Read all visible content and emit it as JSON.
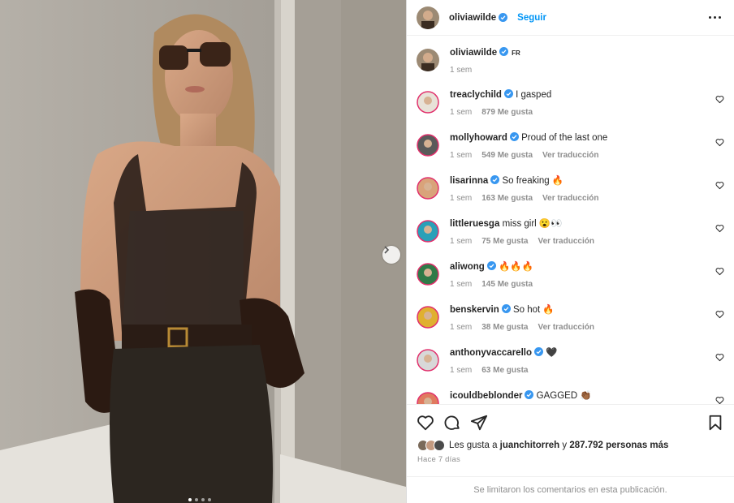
{
  "post": {
    "author": "oliviawilde",
    "follow_label": "Seguir",
    "caption_time": "1 sem",
    "caption_lang": "FR"
  },
  "comments": [
    {
      "user": "treaclychild",
      "verified": true,
      "text": "I gasped",
      "time": "1 sem",
      "likes": "879 Me gusta",
      "translate": "",
      "avatar_color": "#e8e2d8"
    },
    {
      "user": "mollyhoward",
      "verified": true,
      "text": "Proud of the last one",
      "time": "1 sem",
      "likes": "549 Me gusta",
      "translate": "Ver traducción",
      "avatar_color": "#5a5a5a"
    },
    {
      "user": "lisarinna",
      "verified": true,
      "text": "So freaking 🔥",
      "time": "1 sem",
      "likes": "163 Me gusta",
      "translate": "Ver traducción",
      "avatar_color": "#d9a37a"
    },
    {
      "user": "littleruesga",
      "verified": false,
      "text": "miss girl 😮👀",
      "time": "1 sem",
      "likes": "75 Me gusta",
      "translate": "Ver traducción",
      "avatar_color": "#2aa0b8"
    },
    {
      "user": "aliwong",
      "verified": true,
      "text": "🔥🔥🔥",
      "time": "1 sem",
      "likes": "145 Me gusta",
      "translate": "",
      "avatar_color": "#2f7a48"
    },
    {
      "user": "benskervin",
      "verified": true,
      "text": "So hot 🔥",
      "time": "1 sem",
      "likes": "38 Me gusta",
      "translate": "Ver traducción",
      "avatar_color": "#e0b030"
    },
    {
      "user": "anthonyvaccarello",
      "verified": true,
      "text": "🖤",
      "time": "1 sem",
      "likes": "63 Me gusta",
      "translate": "",
      "avatar_color": "#d8d8d8"
    },
    {
      "user": "icouldbeblonder",
      "verified": true,
      "text": "GAGGED 👏🏾",
      "time": "",
      "likes": "",
      "translate": "",
      "avatar_color": "#e07a5f"
    }
  ],
  "likes": {
    "prefix": "Les gusta a",
    "user": "juanchitorreh",
    "middle": "y",
    "others": "287.792 personas más"
  },
  "posted_ago": "Hace 7 días",
  "comments_limited": "Se limitaron los comentarios en esta publicación.",
  "colors": {
    "link": "#0095f6",
    "verified": "#3897f0",
    "muted": "#8e8e8e"
  },
  "icons": [
    "more-icon",
    "like-icon",
    "comment-icon",
    "share-icon",
    "save-icon",
    "heart-icon",
    "verified-icon",
    "next-arrow-icon"
  ],
  "carousel": {
    "slides": 4,
    "active": 1
  }
}
